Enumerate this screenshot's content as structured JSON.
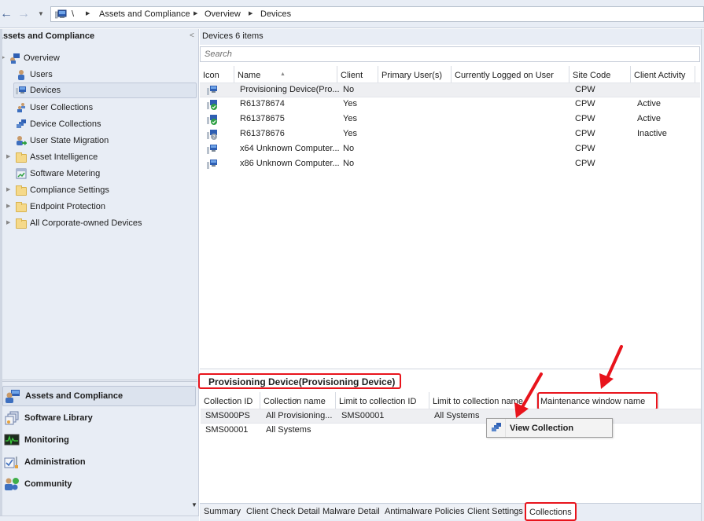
{
  "navigation": {
    "back_icon": "back-arrow-icon",
    "forward_icon": "forward-arrow-icon",
    "history_icon": "dropdown-icon",
    "breadcrumb": [
      "\\",
      "Assets and Compliance",
      "Overview",
      "Devices"
    ]
  },
  "left_pane": {
    "title": "Assets and Compliance",
    "collapse_glyph": "<",
    "tree": [
      {
        "label": "Overview",
        "icon": "overview-icon",
        "expander": true
      },
      {
        "label": "Users",
        "icon": "user-icon"
      },
      {
        "label": "Devices",
        "icon": "device-icon",
        "selected": true
      },
      {
        "label": "User Collections",
        "icon": "user-collections-icon"
      },
      {
        "label": "Device Collections",
        "icon": "device-collections-icon"
      },
      {
        "label": "User State Migration",
        "icon": "user-state-migration-icon"
      },
      {
        "label": "Asset Intelligence",
        "icon": "folder-icon",
        "expander": true
      },
      {
        "label": "Software Metering",
        "icon": "software-metering-icon"
      },
      {
        "label": "Compliance Settings",
        "icon": "folder-icon",
        "expander": true
      },
      {
        "label": "Endpoint Protection",
        "icon": "folder-icon",
        "expander": true
      },
      {
        "label": "All Corporate-owned Devices",
        "icon": "folder-icon",
        "expander": true
      }
    ],
    "workspaces": [
      {
        "label": "Assets and Compliance",
        "icon": "assets-compliance-icon",
        "selected": true
      },
      {
        "label": "Software Library",
        "icon": "software-library-icon"
      },
      {
        "label": "Monitoring",
        "icon": "monitoring-icon"
      },
      {
        "label": "Administration",
        "icon": "administration-icon"
      },
      {
        "label": "Community",
        "icon": "community-icon"
      }
    ]
  },
  "main": {
    "title": "Devices 6 items",
    "search": {
      "placeholder": "Search",
      "value": ""
    },
    "columns": [
      "Icon",
      "Name",
      "Client",
      "Primary User(s)",
      "Currently Logged on User",
      "Site Code",
      "Client Activity"
    ],
    "sorted_column": "Name",
    "rows": [
      {
        "icon": "device-icon",
        "name": "Provisioning Device(Pro...",
        "client": "No",
        "primary_users": "",
        "logged_on_user": "",
        "site_code": "CPW",
        "client_activity": "",
        "selected": true
      },
      {
        "icon": "device-active-icon",
        "name": "R61378674",
        "client": "Yes",
        "primary_users": "",
        "logged_on_user": "",
        "site_code": "CPW",
        "client_activity": "Active"
      },
      {
        "icon": "device-active-icon",
        "name": "R61378675",
        "client": "Yes",
        "primary_users": "",
        "logged_on_user": "",
        "site_code": "CPW",
        "client_activity": "Active"
      },
      {
        "icon": "device-inactive-icon",
        "name": "R61378676",
        "client": "Yes",
        "primary_users": "",
        "logged_on_user": "",
        "site_code": "CPW",
        "client_activity": "Inactive"
      },
      {
        "icon": "device-icon",
        "name": "x64 Unknown Computer...",
        "client": "No",
        "primary_users": "",
        "logged_on_user": "",
        "site_code": "CPW",
        "client_activity": ""
      },
      {
        "icon": "device-icon",
        "name": "x86 Unknown Computer...",
        "client": "No",
        "primary_users": "",
        "logged_on_user": "",
        "site_code": "CPW",
        "client_activity": ""
      }
    ]
  },
  "details": {
    "title": "Provisioning Device(Provisioning Device)",
    "columns": [
      "Collection ID",
      "Collection name",
      "Limit to collection ID",
      "Limit to collection name",
      "Maintenance window name"
    ],
    "sorted_column": "Collection name",
    "rows": [
      {
        "collection_id": "SMS000PS",
        "collection_name": "All Provisioning...",
        "limit_id": "SMS00001",
        "limit_name": "All Systems",
        "maintenance_window": "",
        "selected": true
      },
      {
        "collection_id": "SMS00001",
        "collection_name": "All Systems",
        "limit_id": "",
        "limit_name": "",
        "maintenance_window": ""
      }
    ],
    "context_menu": {
      "items": [
        {
          "label": "View Collection",
          "icon": "view-collection-icon"
        }
      ]
    },
    "tabs": [
      {
        "label": "Summary"
      },
      {
        "label": "Client Check Detail"
      },
      {
        "label": "Malware Detail"
      },
      {
        "label": "Antimalware Policies"
      },
      {
        "label": "Client Settings"
      },
      {
        "label": "Collections",
        "active": true
      }
    ]
  },
  "annotations": {
    "highlight_color": "#e8141c",
    "highlighted": [
      "Provisioning Device(Provisioning Device)",
      "Maintenance window name",
      "Collections"
    ]
  }
}
